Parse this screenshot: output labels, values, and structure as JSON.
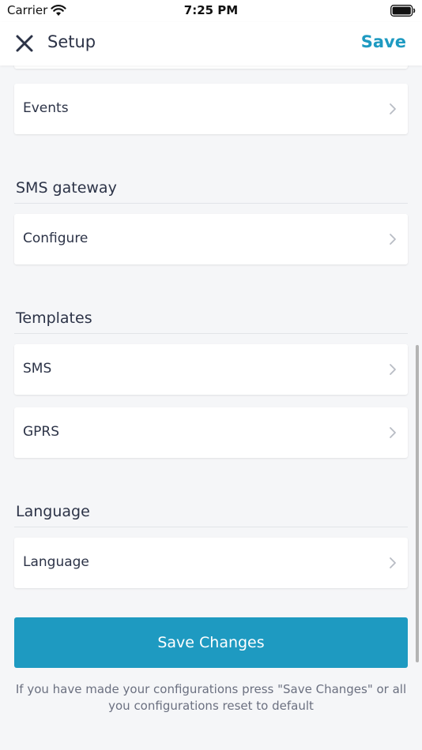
{
  "status_bar": {
    "carrier": "Carrier",
    "time": "7:25 PM"
  },
  "nav": {
    "title": "Setup",
    "save_label": "Save"
  },
  "sections": {
    "top": {
      "items": [
        "Events"
      ]
    },
    "sms_gateway": {
      "header": "SMS gateway",
      "items": [
        "Configure"
      ]
    },
    "templates": {
      "header": "Templates",
      "items": [
        "SMS",
        "GPRS"
      ]
    },
    "language": {
      "header": "Language",
      "items": [
        "Language"
      ]
    }
  },
  "save_changes_label": "Save Changes",
  "hint": "If you have made your configurations press \"Save Changes\" or all you configurations reset to default",
  "colors": {
    "accent": "#1e9ac1",
    "background": "#f5f6f8",
    "text": "#2c3347"
  },
  "icons": [
    "wifi-icon",
    "battery-icon",
    "close-icon",
    "chevron-right-icon"
  ]
}
